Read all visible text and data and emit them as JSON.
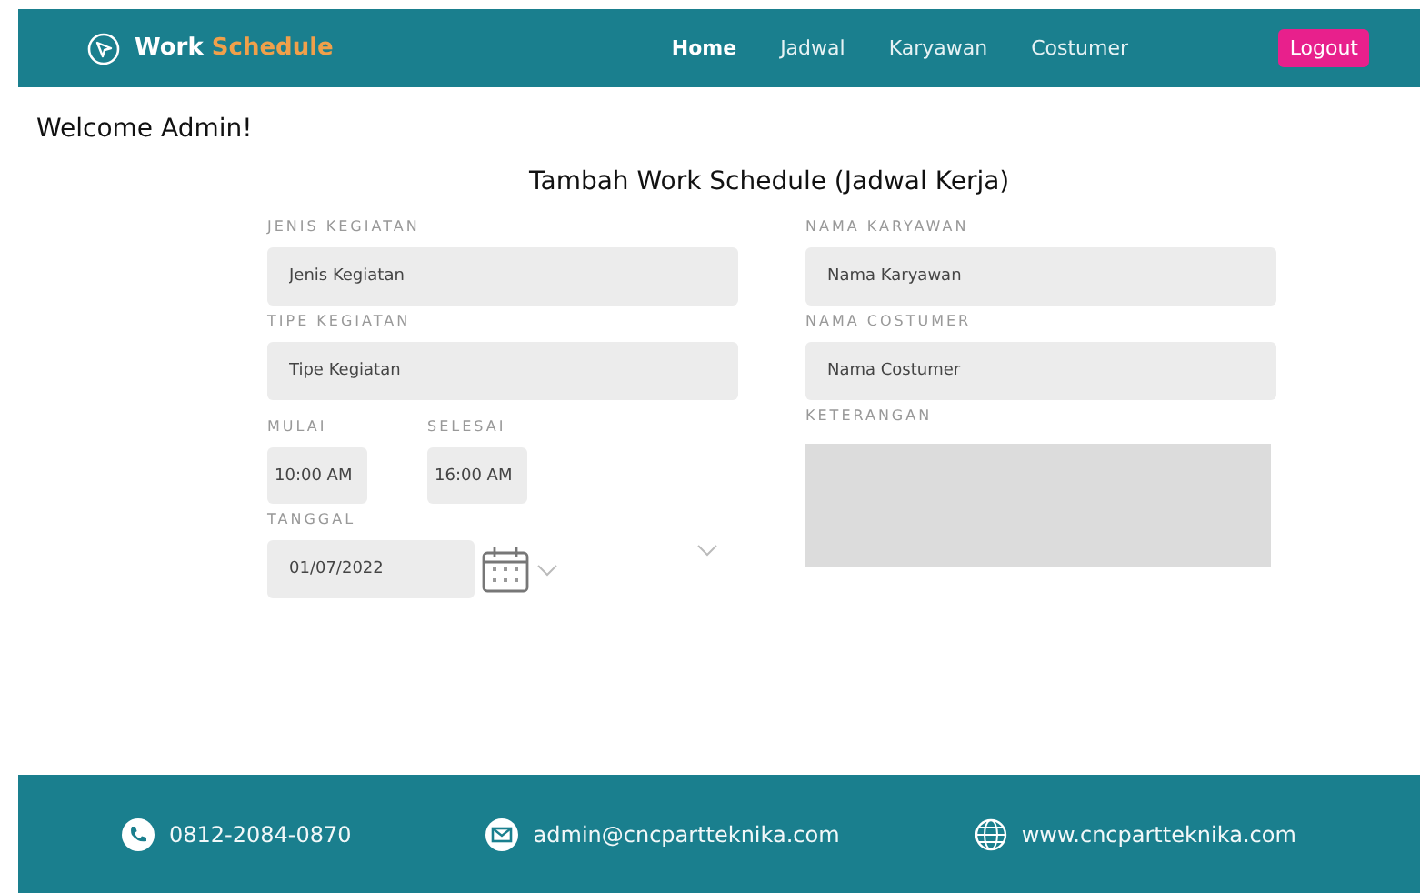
{
  "header": {
    "logo": {
      "part_1": "Work",
      "part_2": "Schedule"
    },
    "nav": [
      {
        "label": "Home",
        "selected": true
      },
      {
        "label": "Jadwal",
        "selected": false
      },
      {
        "label": "Karyawan",
        "selected": false
      },
      {
        "label": "Costumer",
        "selected": false
      }
    ],
    "logout": "Logout"
  },
  "welcome": "Welcome Admin!",
  "form": {
    "title": "Tambah Work Schedule (Jadwal Kerja)",
    "left": [
      {
        "kind": "text",
        "label": "JENIS KEGIATAN",
        "placeholder": "Jenis Kegiatan"
      },
      {
        "kind": "text",
        "label": "TIPE KEGIATAN",
        "placeholder": "Tipe Kegiatan"
      },
      {
        "kind": "times",
        "items": [
          {
            "label": "MULAI",
            "value": "10:00 AM"
          },
          {
            "label": "SELESAI",
            "value": "16:00 AM"
          }
        ]
      },
      {
        "kind": "date",
        "label": "TANGGAL",
        "value": "01/07/2022"
      }
    ],
    "right": [
      {
        "kind": "text",
        "label": "NAMA KARYAWAN",
        "placeholder": "Nama Karyawan"
      },
      {
        "kind": "text",
        "label": "NAMA COSTUMER",
        "placeholder": "Nama Costumer"
      },
      {
        "kind": "area",
        "label": "KETERANGAN"
      }
    ]
  },
  "footer": [
    {
      "kind": "phone",
      "text": "0812-2084-0870"
    },
    {
      "kind": "email",
      "text": "admin@cncpartteknika.com"
    },
    {
      "kind": "web",
      "text": "www.cncpartteknika.com"
    }
  ]
}
